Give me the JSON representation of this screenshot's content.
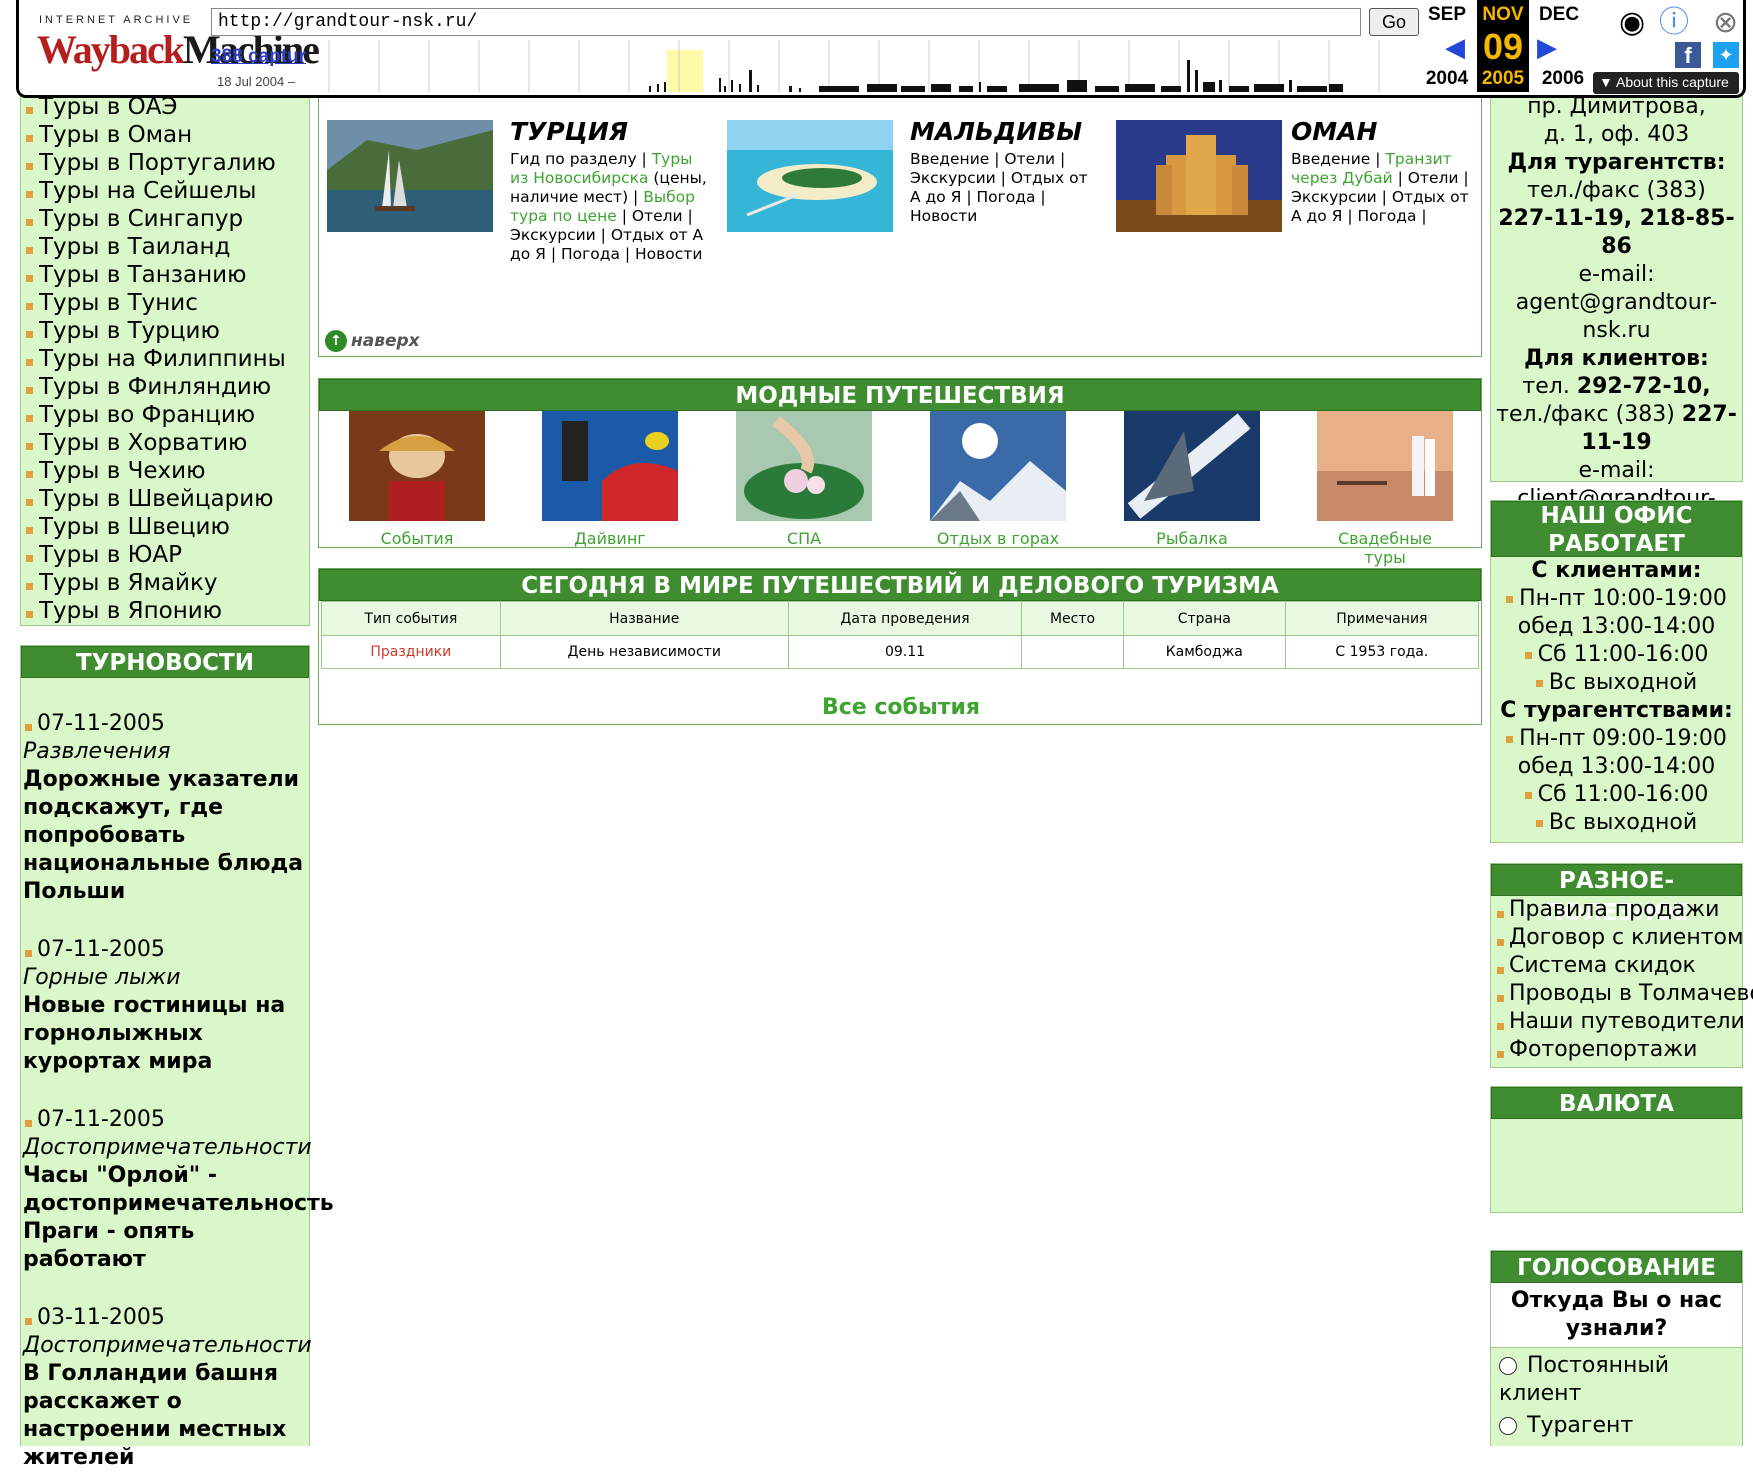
{
  "wayback": {
    "ia_label": "INTERNET ARCHIVE",
    "logo_part1": "Wayback",
    "logo_part2": "Machine",
    "url": "http://grandtour-nsk.ru/",
    "go_label": "Go",
    "captures": "388 captur",
    "date_range": "18 Jul 2004 –",
    "months": {
      "prev": "SEP",
      "cur": "NOV",
      "next": "DEC"
    },
    "day": "09",
    "years": {
      "prev": "2004",
      "cur": "2005",
      "next": "2006"
    },
    "about_label": "About this capture"
  },
  "left_menu": [
    "Туры в ОАЭ",
    "Туры в Оман",
    "Туры в Португалию",
    "Туры на Сейшелы",
    "Туры в Сингапур",
    "Туры в Таиланд",
    "Туры в Танзанию",
    "Туры в Тунис",
    "Туры в Турцию",
    "Туры на Филиппины",
    "Туры в Финляндию",
    "Туры во Францию",
    "Туры в Хорватию",
    "Туры в Чехию",
    "Туры в Швейцарию",
    "Туры в Швецию",
    "Туры в ЮАР",
    "Туры в Ямайку",
    "Туры в Японию"
  ],
  "news": {
    "heading": "ТУРНОВОСТИ",
    "items": [
      {
        "date": "07-11-2005",
        "category": "Развлечения",
        "title": "Дорожные указатели подскажут, где попробовать национальные блюда Польши"
      },
      {
        "date": "07-11-2005",
        "category": "Горные лыжи",
        "title": "Новые гостиницы на горнолыжных курортах мира"
      },
      {
        "date": "07-11-2005",
        "category": "Достопримечательности",
        "title": "Часы \"Орлой\" - достопримечательность Праги - опять работают"
      },
      {
        "date": "03-11-2005",
        "category": "Достопримечательности",
        "title": "В Голландии башня расскажет о настроении местных жителей"
      }
    ]
  },
  "destinations": [
    {
      "title": "ТУРЦИЯ",
      "links_html_parts": [
        {
          "t": "Гид по разделу | ",
          "g": false
        },
        {
          "t": "Туры из Новосибирска",
          "g": true
        },
        {
          "t": " (цены, наличие мест) | ",
          "g": false
        },
        {
          "t": "Выбор тура по цене",
          "g": true
        },
        {
          "t": " | Отели | Экскурсии | Отдых от А до Я | Погода | Новости",
          "g": false
        }
      ]
    },
    {
      "title": "МАЛЬДИВЫ",
      "links_html_parts": [
        {
          "t": "Введение | Отели | Экскурсии | Отдых от А до Я | Погода | Новости",
          "g": false
        }
      ]
    },
    {
      "title": "ОМАН",
      "links_html_parts": [
        {
          "t": "Введение | ",
          "g": false
        },
        {
          "t": "Транзит через Дубай",
          "g": true
        },
        {
          "t": " | Отели | Экскурсии | Отдых от А до Я | Погода |",
          "g": false
        }
      ]
    }
  ],
  "back_to_top": "наверх",
  "fashion": {
    "heading": "МОДНЫЕ ПУТЕШЕСТВИЯ",
    "items": [
      "События",
      "Дайвинг",
      "СПА",
      "Отдых в горах",
      "Рыбалка",
      "Свадебные туры"
    ]
  },
  "events": {
    "heading": "СЕГОДНЯ В МИРЕ ПУТЕШЕСТВИЙ И ДЕЛОВОГО ТУРИЗМА",
    "columns": [
      "Тип события",
      "Название",
      "Дата проведения",
      "Место",
      "Страна",
      "Примечания"
    ],
    "rows": [
      [
        "Праздники",
        "День независимости",
        "09.11",
        "",
        "Камбоджа",
        "С 1953 года."
      ]
    ],
    "all_label": "Все события"
  },
  "contacts": {
    "address1": "пр. Димитрова,",
    "address2": "д. 1, оф. 403",
    "agents_label": "Для турагентств:",
    "agents_phone_label": "тел./факс (383)",
    "agents_phones": "227-11-19, 218-85-86",
    "email_label": "e-mail:",
    "agents_email": "agent@grandtour-nsk.ru",
    "clients_label": "Для клиентов:",
    "clients_tel_prefix": "тел.",
    "clients_tel": "292-72-10,",
    "clients_fax_prefix": "тел./факс (383)",
    "clients_fax": "227-11-19",
    "clients_email": "client@grandtour-nsk.ru"
  },
  "office": {
    "heading": "НАШ ОФИС РАБОТАЕТ",
    "clients_label": "С клиентами:",
    "clients_hours": [
      "Пн-пт 10:00-19:00",
      "обед 13:00-14:00",
      "Сб 11:00-16:00",
      "Вс выходной"
    ],
    "agents_label": "С турагентствами:",
    "agents_hours": [
      "Пн-пт 09:00-19:00",
      "обед 13:00-14:00",
      "Сб 11:00-16:00",
      "Вс выходной"
    ]
  },
  "useful": {
    "heading": "РАЗНОЕ-ПОЛЕЗНОЕ",
    "items": [
      "Правила продажи",
      "Договор с клиентом",
      "Система скидок",
      "Проводы в Толмачево",
      "Наши путеводители",
      "Фоторепортажи"
    ]
  },
  "currency": {
    "heading": "ВАЛЮТА"
  },
  "poll": {
    "heading": "ГОЛОСОВАНИЕ",
    "question": "Откуда Вы о нас узнали?",
    "options": [
      "Постоянный клиент",
      "Турагент"
    ]
  },
  "colors": {
    "brand_green": "#3f8d30",
    "panel_green": "#d9f7c9",
    "link_green": "#3fa332",
    "bullet": "#e0a040"
  }
}
